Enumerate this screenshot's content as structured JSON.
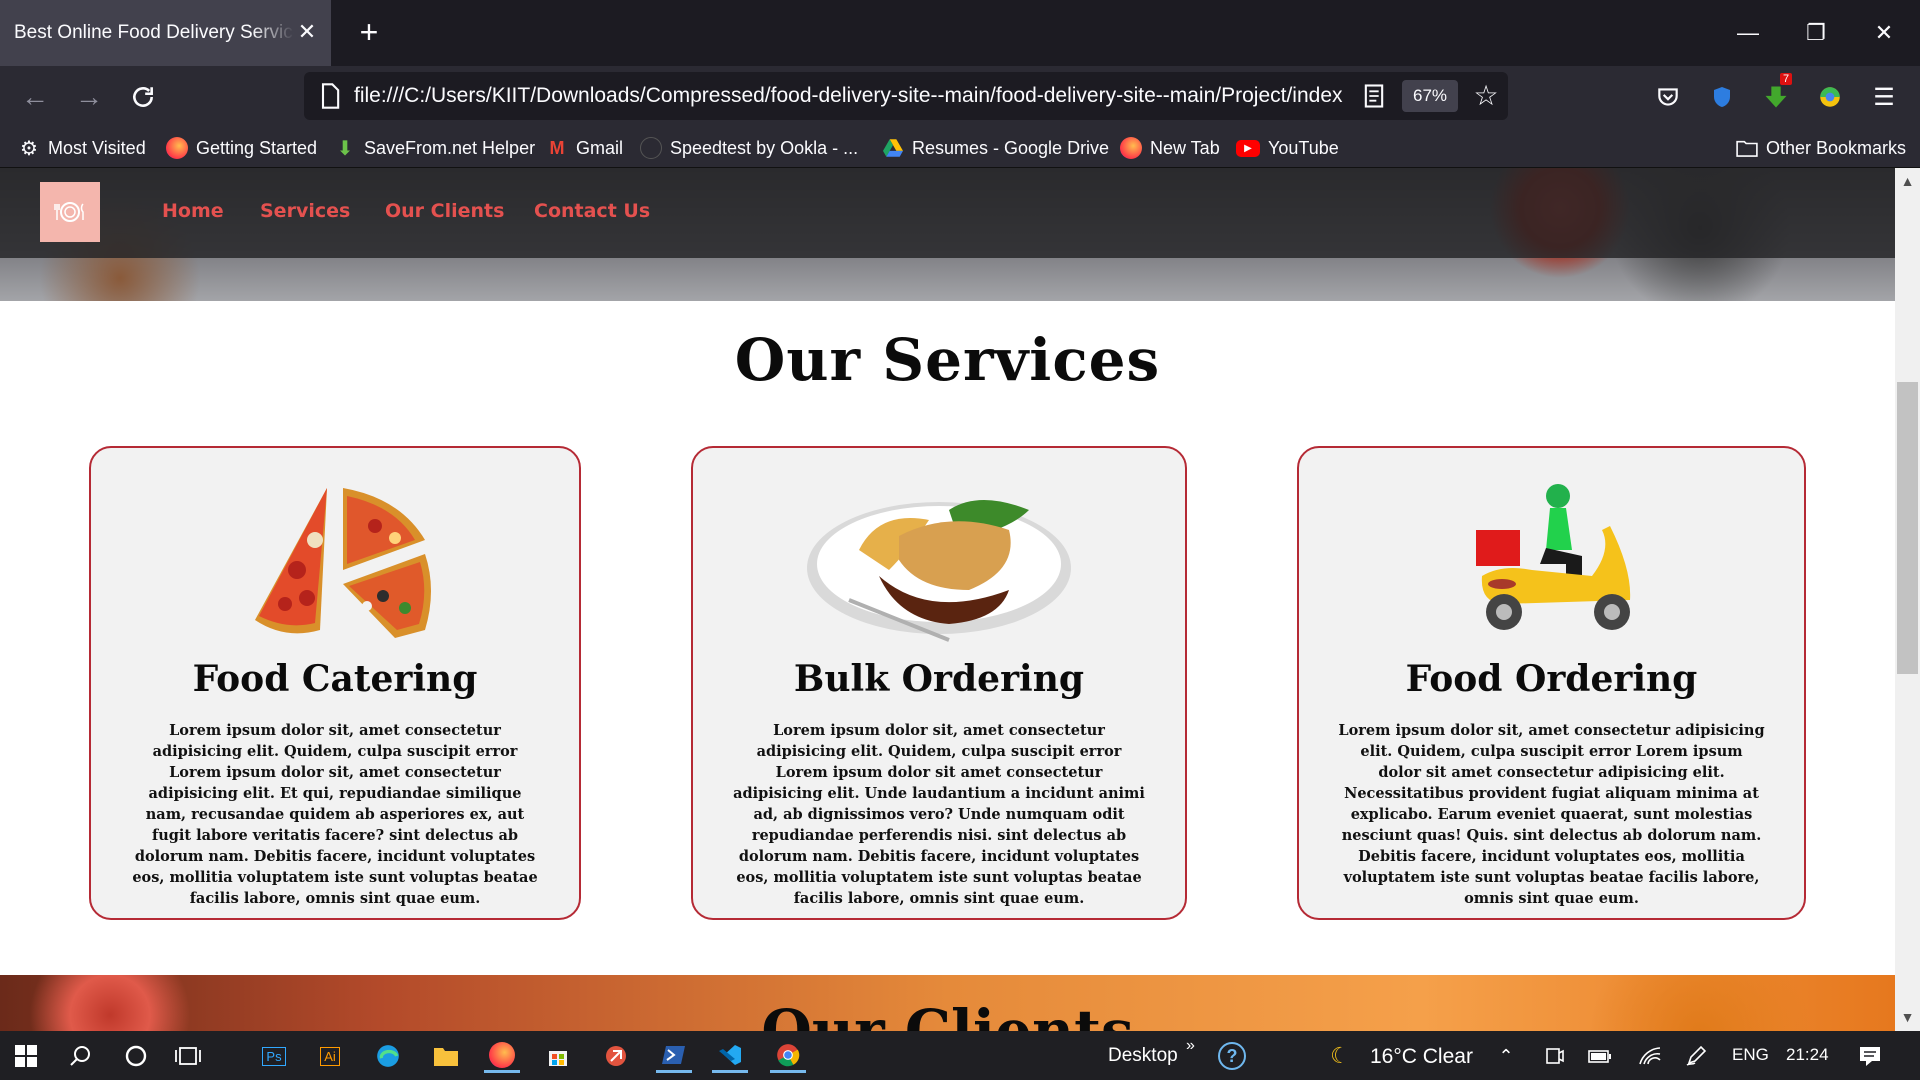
{
  "browser": {
    "tab_title": "Best Online Food Delivery Service in",
    "url": "file:///C:/Users/KIIT/Downloads/Compressed/food-delivery-site--main/food-delivery-site--main/Project/index",
    "zoom": "67%",
    "bookmarks": [
      {
        "label": "Most Visited",
        "icon": "gear-icon"
      },
      {
        "label": "Getting Started",
        "icon": "firefox-icon"
      },
      {
        "label": "SaveFrom.net Helper",
        "icon": "download-arrow-icon"
      },
      {
        "label": "Gmail",
        "icon": "gmail-icon"
      },
      {
        "label": "Speedtest by Ookla - ...",
        "icon": "speedtest-icon"
      },
      {
        "label": "Resumes - Google Drive",
        "icon": "google-drive-icon"
      },
      {
        "label": "New Tab",
        "icon": "firefox-icon"
      },
      {
        "label": "YouTube",
        "icon": "youtube-icon"
      }
    ],
    "other_bookmarks": "Other Bookmarks",
    "extension_badge": "7"
  },
  "site": {
    "nav": [
      "Home",
      "Services",
      "Our Clients",
      "Contact Us"
    ],
    "services_title": "Our Services",
    "cards": [
      {
        "title": "Food Catering",
        "image": "pizza-slices",
        "text": "Lorem ipsum dolor sit, amet consectetur adipisicing elit. Quidem, culpa suscipit error Lorem ipsum dolor sit, amet consectetur adipisicing elit. Et qui, repudiandae similique nam, recusandae quidem ab asperiores ex, aut fugit labore veritatis facere? sint delectus ab dolorum nam. Debitis facere, incidunt voluptates eos, mollitia voluptatem iste sunt voluptas beatae facilis labore, omnis sint quae eum."
      },
      {
        "title": "Bulk Ordering",
        "image": "meal-plate",
        "text": "Lorem ipsum dolor sit, amet consectetur adipisicing elit. Quidem, culpa suscipit error Lorem ipsum dolor sit amet consectetur adipisicing elit. Unde laudantium a incidunt animi ad, ab dignissimos vero? Unde numquam odit repudiandae perferendis nisi. sint delectus ab dolorum nam. Debitis facere, incidunt voluptates eos, mollitia voluptatem iste sunt voluptas beatae facilis labore, omnis sint quae eum."
      },
      {
        "title": "Food Ordering",
        "image": "delivery-scooter",
        "text": "Lorem ipsum dolor sit, amet consectetur adipisicing elit. Quidem, culpa suscipit error Lorem ipsum dolor sit amet consectetur adipisicing elit. Necessitatibus provident fugiat aliquam minima at explicabo. Earum eveniet quaerat, sunt molestias nesciunt quas! Quis. sint delectus ab dolorum nam. Debitis facere, incidunt voluptates eos, mollitia voluptatem iste sunt voluptas beatae facilis labore, omnis sint quae eum."
      }
    ],
    "clients_title": "Our Clients"
  },
  "taskbar": {
    "desktop_label": "Desktop",
    "weather": "16°C  Clear",
    "language": "ENG",
    "time": "21:24"
  },
  "colors": {
    "accent_red": "#e4514f",
    "card_border": "#b52a35"
  }
}
